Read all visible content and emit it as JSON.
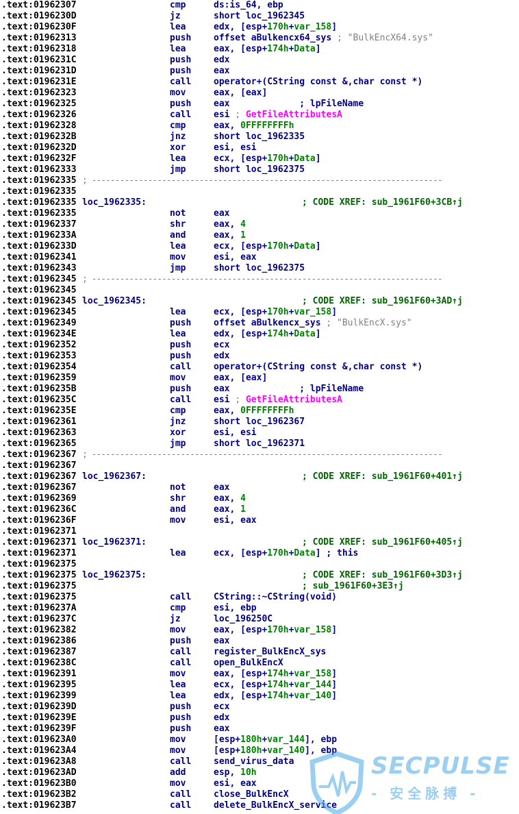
{
  "disassembly": {
    "lines": [
      {
        "addr": ".text:01962307",
        "mnem": "cmp",
        "ops": [
          {
            "t": "ds:is_64, ebp"
          }
        ]
      },
      {
        "addr": ".text:0196230D",
        "mnem": "jz",
        "ops": [
          {
            "t": "short loc_1962345"
          }
        ]
      },
      {
        "addr": ".text:0196230F",
        "mnem": "lea",
        "ops": [
          {
            "t": "edx, [esp+"
          },
          {
            "t": "170h",
            "c": "num"
          },
          {
            "t": "+"
          },
          {
            "t": "var_158",
            "c": "var"
          },
          {
            "t": "]"
          }
        ]
      },
      {
        "addr": ".text:01962313",
        "mnem": "push",
        "ops": [
          {
            "t": "offset aBulkencx64_sys "
          },
          {
            "t": "; \"BulkEncX64.sys\"",
            "c": "cmt"
          }
        ]
      },
      {
        "addr": ".text:01962318",
        "mnem": "lea",
        "ops": [
          {
            "t": "eax, [esp+"
          },
          {
            "t": "174h",
            "c": "num"
          },
          {
            "t": "+"
          },
          {
            "t": "Data",
            "c": "var"
          },
          {
            "t": "]"
          }
        ]
      },
      {
        "addr": ".text:0196231C",
        "mnem": "push",
        "ops": [
          {
            "t": "edx"
          }
        ]
      },
      {
        "addr": ".text:0196231D",
        "mnem": "push",
        "ops": [
          {
            "t": "eax"
          }
        ]
      },
      {
        "addr": ".text:0196231E",
        "mnem": "call",
        "ops": [
          {
            "t": "operator+(CString const &,char const *)"
          }
        ]
      },
      {
        "addr": ".text:01962323",
        "mnem": "mov",
        "ops": [
          {
            "t": "eax, [eax]"
          }
        ]
      },
      {
        "addr": ".text:01962325",
        "mnem": "push",
        "ops": [
          {
            "t": "eax             "
          },
          {
            "t": "; lpFileName",
            "c": "cmtb"
          }
        ]
      },
      {
        "addr": ".text:01962326",
        "mnem": "call",
        "ops": [
          {
            "t": "esi "
          },
          {
            "t": "; ",
            "c": "cmt"
          },
          {
            "t": "GetFileAttributesA",
            "c": "api"
          }
        ]
      },
      {
        "addr": ".text:01962328",
        "mnem": "cmp",
        "ops": [
          {
            "t": "eax, "
          },
          {
            "t": "0FFFFFFFFh",
            "c": "num"
          }
        ]
      },
      {
        "addr": ".text:0196232B",
        "mnem": "jnz",
        "ops": [
          {
            "t": "short loc_1962335"
          }
        ]
      },
      {
        "addr": ".text:0196232D",
        "mnem": "xor",
        "ops": [
          {
            "t": "esi, esi"
          }
        ]
      },
      {
        "addr": ".text:0196232F",
        "mnem": "lea",
        "ops": [
          {
            "t": "ecx, [esp+"
          },
          {
            "t": "170h",
            "c": "num"
          },
          {
            "t": "+"
          },
          {
            "t": "Data",
            "c": "var"
          },
          {
            "t": "]"
          }
        ]
      },
      {
        "addr": ".text:01962333",
        "mnem": "jmp",
        "ops": [
          {
            "t": "short loc_1962375"
          }
        ]
      },
      {
        "addr": ".text:01962335",
        "sep": true
      },
      {
        "addr": ".text:01962335"
      },
      {
        "addr": ".text:01962335",
        "label": "loc_1962335:",
        "xref": "; CODE XREF: sub_1961F60+3CB↑j"
      },
      {
        "addr": ".text:01962335",
        "mnem": "not",
        "ops": [
          {
            "t": "eax"
          }
        ]
      },
      {
        "addr": ".text:01962337",
        "mnem": "shr",
        "ops": [
          {
            "t": "eax, "
          },
          {
            "t": "4",
            "c": "num"
          }
        ]
      },
      {
        "addr": ".text:0196233A",
        "mnem": "and",
        "ops": [
          {
            "t": "eax, "
          },
          {
            "t": "1",
            "c": "num"
          }
        ]
      },
      {
        "addr": ".text:0196233D",
        "mnem": "lea",
        "ops": [
          {
            "t": "ecx, [esp+"
          },
          {
            "t": "170h",
            "c": "num"
          },
          {
            "t": "+"
          },
          {
            "t": "Data",
            "c": "var"
          },
          {
            "t": "]"
          }
        ]
      },
      {
        "addr": ".text:01962341",
        "mnem": "mov",
        "ops": [
          {
            "t": "esi, eax"
          }
        ]
      },
      {
        "addr": ".text:01962343",
        "mnem": "jmp",
        "ops": [
          {
            "t": "short loc_1962375"
          }
        ]
      },
      {
        "addr": ".text:01962345",
        "sep": true
      },
      {
        "addr": ".text:01962345"
      },
      {
        "addr": ".text:01962345",
        "label": "loc_1962345:",
        "xref": "; CODE XREF: sub_1961F60+3AD↑j"
      },
      {
        "addr": ".text:01962345",
        "mnem": "lea",
        "ops": [
          {
            "t": "ecx, [esp+"
          },
          {
            "t": "170h",
            "c": "num"
          },
          {
            "t": "+"
          },
          {
            "t": "var_158",
            "c": "var"
          },
          {
            "t": "]"
          }
        ]
      },
      {
        "addr": ".text:01962349",
        "mnem": "push",
        "ops": [
          {
            "t": "offset aBulkencx_sys "
          },
          {
            "t": "; \"BulkEncX.sys\"",
            "c": "cmt"
          }
        ]
      },
      {
        "addr": ".text:0196234E",
        "mnem": "lea",
        "ops": [
          {
            "t": "edx, [esp+"
          },
          {
            "t": "174h",
            "c": "num"
          },
          {
            "t": "+"
          },
          {
            "t": "Data",
            "c": "var"
          },
          {
            "t": "]"
          }
        ]
      },
      {
        "addr": ".text:01962352",
        "mnem": "push",
        "ops": [
          {
            "t": "ecx"
          }
        ]
      },
      {
        "addr": ".text:01962353",
        "mnem": "push",
        "ops": [
          {
            "t": "edx"
          }
        ]
      },
      {
        "addr": ".text:01962354",
        "mnem": "call",
        "ops": [
          {
            "t": "operator+(CString const &,char const *)"
          }
        ]
      },
      {
        "addr": ".text:01962359",
        "mnem": "mov",
        "ops": [
          {
            "t": "eax, [eax]"
          }
        ]
      },
      {
        "addr": ".text:0196235B",
        "mnem": "push",
        "ops": [
          {
            "t": "eax             "
          },
          {
            "t": "; lpFileName",
            "c": "cmtb"
          }
        ]
      },
      {
        "addr": ".text:0196235C",
        "mnem": "call",
        "ops": [
          {
            "t": "esi "
          },
          {
            "t": "; ",
            "c": "cmt"
          },
          {
            "t": "GetFileAttributesA",
            "c": "api"
          }
        ]
      },
      {
        "addr": ".text:0196235E",
        "mnem": "cmp",
        "ops": [
          {
            "t": "eax, "
          },
          {
            "t": "0FFFFFFFFh",
            "c": "num"
          }
        ]
      },
      {
        "addr": ".text:01962361",
        "mnem": "jnz",
        "ops": [
          {
            "t": "short loc_1962367"
          }
        ]
      },
      {
        "addr": ".text:01962363",
        "mnem": "xor",
        "ops": [
          {
            "t": "esi, esi"
          }
        ]
      },
      {
        "addr": ".text:01962365",
        "mnem": "jmp",
        "ops": [
          {
            "t": "short loc_1962371"
          }
        ]
      },
      {
        "addr": ".text:01962367",
        "sep": true
      },
      {
        "addr": ".text:01962367"
      },
      {
        "addr": ".text:01962367",
        "label": "loc_1962367:",
        "xref": "; CODE XREF: sub_1961F60+401↑j"
      },
      {
        "addr": ".text:01962367",
        "mnem": "not",
        "ops": [
          {
            "t": "eax"
          }
        ]
      },
      {
        "addr": ".text:01962369",
        "mnem": "shr",
        "ops": [
          {
            "t": "eax, "
          },
          {
            "t": "4",
            "c": "num"
          }
        ]
      },
      {
        "addr": ".text:0196236C",
        "mnem": "and",
        "ops": [
          {
            "t": "eax, "
          },
          {
            "t": "1",
            "c": "num"
          }
        ]
      },
      {
        "addr": ".text:0196236F",
        "mnem": "mov",
        "ops": [
          {
            "t": "esi, eax"
          }
        ]
      },
      {
        "addr": ".text:01962371"
      },
      {
        "addr": ".text:01962371",
        "label": "loc_1962371:",
        "xref": "; CODE XREF: sub_1961F60+405↑j"
      },
      {
        "addr": ".text:01962371",
        "mnem": "lea",
        "ops": [
          {
            "t": "ecx, [esp+"
          },
          {
            "t": "170h",
            "c": "num"
          },
          {
            "t": "+"
          },
          {
            "t": "Data",
            "c": "var"
          },
          {
            "t": "] "
          },
          {
            "t": "; this",
            "c": "cmtb"
          }
        ]
      },
      {
        "addr": ".text:01962375"
      },
      {
        "addr": ".text:01962375",
        "label": "loc_1962375:",
        "xref": "; CODE XREF: sub_1961F60+3D3↑j"
      },
      {
        "addr": ".text:01962375",
        "xref": "; sub_1961F60+3E3↑j"
      },
      {
        "addr": ".text:01962375",
        "mnem": "call",
        "ops": [
          {
            "t": "CString::~CString(void)"
          }
        ]
      },
      {
        "addr": ".text:0196237A",
        "mnem": "cmp",
        "ops": [
          {
            "t": "esi, ebp"
          }
        ]
      },
      {
        "addr": ".text:0196237C",
        "mnem": "jz",
        "ops": [
          {
            "t": "loc_196250C"
          }
        ]
      },
      {
        "addr": ".text:01962382",
        "mnem": "mov",
        "ops": [
          {
            "t": "eax, [esp+"
          },
          {
            "t": "170h",
            "c": "num"
          },
          {
            "t": "+"
          },
          {
            "t": "var_158",
            "c": "var"
          },
          {
            "t": "]"
          }
        ]
      },
      {
        "addr": ".text:01962386",
        "mnem": "push",
        "ops": [
          {
            "t": "eax"
          }
        ]
      },
      {
        "addr": ".text:01962387",
        "mnem": "call",
        "ops": [
          {
            "t": "register_BulkEncX_sys"
          }
        ]
      },
      {
        "addr": ".text:0196238C",
        "mnem": "call",
        "ops": [
          {
            "t": "open_BulkEncX"
          }
        ]
      },
      {
        "addr": ".text:01962391",
        "mnem": "mov",
        "ops": [
          {
            "t": "eax, [esp+"
          },
          {
            "t": "174h",
            "c": "num"
          },
          {
            "t": "+"
          },
          {
            "t": "var_158",
            "c": "var"
          },
          {
            "t": "]"
          }
        ]
      },
      {
        "addr": ".text:01962395",
        "mnem": "lea",
        "ops": [
          {
            "t": "ecx, [esp+"
          },
          {
            "t": "174h",
            "c": "num"
          },
          {
            "t": "+"
          },
          {
            "t": "var_144",
            "c": "var"
          },
          {
            "t": "]"
          }
        ]
      },
      {
        "addr": ".text:01962399",
        "mnem": "lea",
        "ops": [
          {
            "t": "edx, [esp+"
          },
          {
            "t": "174h",
            "c": "num"
          },
          {
            "t": "+"
          },
          {
            "t": "var_140",
            "c": "var"
          },
          {
            "t": "]"
          }
        ]
      },
      {
        "addr": ".text:0196239D",
        "mnem": "push",
        "ops": [
          {
            "t": "ecx"
          }
        ]
      },
      {
        "addr": ".text:0196239E",
        "mnem": "push",
        "ops": [
          {
            "t": "edx"
          }
        ]
      },
      {
        "addr": ".text:0196239F",
        "mnem": "push",
        "ops": [
          {
            "t": "eax"
          }
        ]
      },
      {
        "addr": ".text:019623A0",
        "mnem": "mov",
        "ops": [
          {
            "t": "[esp+"
          },
          {
            "t": "180h",
            "c": "num"
          },
          {
            "t": "+"
          },
          {
            "t": "var_144",
            "c": "var"
          },
          {
            "t": "], ebp"
          }
        ]
      },
      {
        "addr": ".text:019623A4",
        "mnem": "mov",
        "ops": [
          {
            "t": "[esp+"
          },
          {
            "t": "180h",
            "c": "num"
          },
          {
            "t": "+"
          },
          {
            "t": "var_140",
            "c": "var"
          },
          {
            "t": "], ebp"
          }
        ]
      },
      {
        "addr": ".text:019623A8",
        "mnem": "call",
        "ops": [
          {
            "t": "send_virus_data"
          }
        ]
      },
      {
        "addr": ".text:019623AD",
        "mnem": "add",
        "ops": [
          {
            "t": "esp, "
          },
          {
            "t": "10h",
            "c": "num"
          }
        ]
      },
      {
        "addr": ".text:019623B0",
        "mnem": "mov",
        "ops": [
          {
            "t": "esi, eax"
          }
        ]
      },
      {
        "addr": ".text:019623B2",
        "mnem": "call",
        "ops": [
          {
            "t": "close_BulkEncX"
          }
        ]
      },
      {
        "addr": ".text:019623B7",
        "mnem": "call",
        "ops": [
          {
            "t": "delete_BulkEncX_service"
          }
        ]
      }
    ],
    "separator": "; ---------------------------------------------------------------------------"
  },
  "watermark": {
    "title": "SECPULSE",
    "subtitle": "- 安全脉搏 -",
    "icon": "shield-pulse-icon",
    "color": "#4aa9e6"
  },
  "colors": {
    "address": "#000000",
    "code": "#000080",
    "variable": "#008000",
    "api": "#ff00ff",
    "comment": "#808080",
    "xref": "#006400"
  }
}
